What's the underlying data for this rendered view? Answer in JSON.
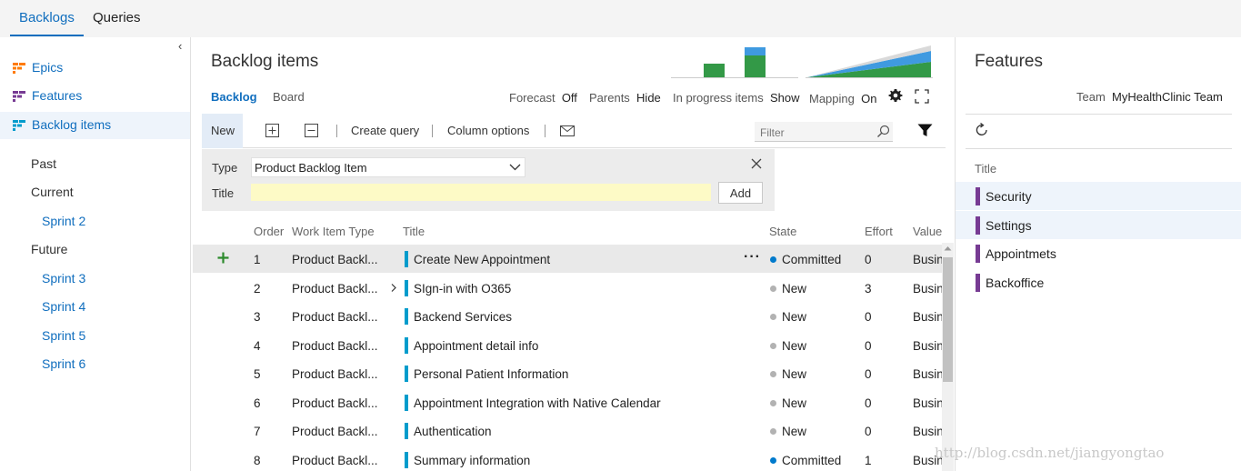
{
  "top_tabs": [
    "Backlogs",
    "Queries"
  ],
  "left_nav": {
    "items": [
      {
        "label": "Epics",
        "icon": "epics-icon",
        "color": "#ff7b00"
      },
      {
        "label": "Features",
        "icon": "features-icon",
        "color": "#773b93"
      },
      {
        "label": "Backlog items",
        "icon": "backlog-items-icon",
        "color": "#009ccc"
      }
    ],
    "iterations": {
      "past": "Past",
      "current": "Current",
      "current_sprints": [
        "Sprint 2"
      ],
      "future": "Future",
      "future_sprints": [
        "Sprint 3",
        "Sprint 4",
        "Sprint 5",
        "Sprint 6"
      ]
    }
  },
  "main": {
    "title": "Backlog items",
    "view_tabs": [
      "Backlog",
      "Board"
    ],
    "options": {
      "forecast_label": "Forecast",
      "forecast_value": "Off",
      "parents_label": "Parents",
      "parents_value": "Hide",
      "inprogress_label": "In progress items",
      "inprogress_value": "Show",
      "mapping_label": "Mapping",
      "mapping_value": "On"
    },
    "toolbar": {
      "new_label": "New",
      "create_query": "Create query",
      "column_options": "Column options",
      "filter_placeholder": "Filter"
    },
    "new_item_panel": {
      "type_label": "Type",
      "type_value": "Product Backlog Item",
      "title_label": "Title",
      "add_label": "Add"
    },
    "columns": [
      "Order",
      "Work Item Type",
      "Title",
      "State",
      "Effort",
      "Value Ar"
    ],
    "rows": [
      {
        "order": "1",
        "type": "Product Backl...",
        "title": "Create New Appointment",
        "state": "Committed",
        "effort": "0",
        "value": "Busin"
      },
      {
        "order": "2",
        "type": "Product Backl...",
        "title": "SIgn-in with O365",
        "state": "New",
        "effort": "3",
        "value": "Busin"
      },
      {
        "order": "3",
        "type": "Product Backl...",
        "title": "Backend Services",
        "state": "New",
        "effort": "0",
        "value": "Busin"
      },
      {
        "order": "4",
        "type": "Product Backl...",
        "title": "Appointment detail info",
        "state": "New",
        "effort": "0",
        "value": "Busin"
      },
      {
        "order": "5",
        "type": "Product Backl...",
        "title": "Personal Patient Information",
        "state": "New",
        "effort": "0",
        "value": "Busin"
      },
      {
        "order": "6",
        "type": "Product Backl...",
        "title": "Appointment Integration with Native Calendar",
        "state": "New",
        "effort": "0",
        "value": "Busin"
      },
      {
        "order": "7",
        "type": "Product Backl...",
        "title": "Authentication",
        "state": "New",
        "effort": "0",
        "value": "Busin"
      },
      {
        "order": "8",
        "type": "Product Backl...",
        "title": "Summary information",
        "state": "Committed",
        "effort": "1",
        "value": "Busin"
      }
    ],
    "state_colors": {
      "Committed": "#007acc",
      "New": "#b2b2b2"
    }
  },
  "features_panel": {
    "title": "Features",
    "team_label": "Team",
    "team_value": "MyHealthClinic Team",
    "column": "Title",
    "items": [
      "Security",
      "Settings",
      "Appointmets",
      "Backoffice"
    ]
  },
  "watermark": "http://blog.csdn.net/jiangyongtao"
}
